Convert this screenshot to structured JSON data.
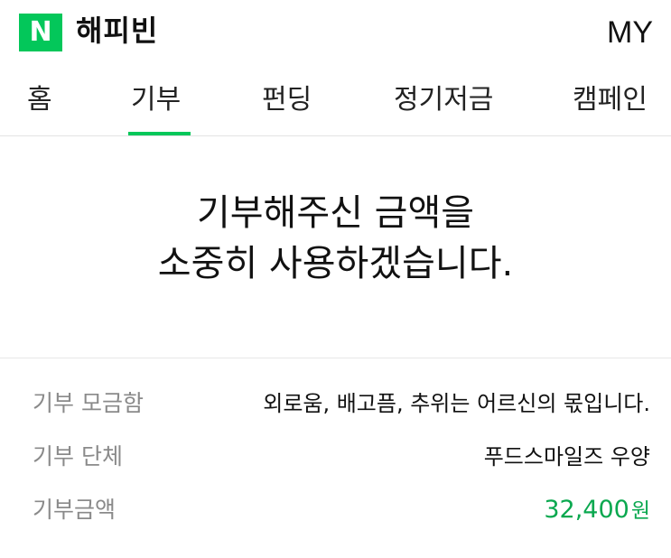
{
  "header": {
    "logo_letter": "N",
    "app_title": "해피빈",
    "my_label": "MY"
  },
  "tabs": [
    {
      "label": "홈"
    },
    {
      "label": "기부",
      "active": true
    },
    {
      "label": "펀딩"
    },
    {
      "label": "정기저금"
    },
    {
      "label": "캠페인"
    }
  ],
  "message": {
    "line1": "기부해주신 금액을",
    "line2": "소중히 사용하겠습니다."
  },
  "details": {
    "fundraiser_label": "기부 모금함",
    "fundraiser_value": "외로움, 배고픔, 추위는 어르신의 몫입니다.",
    "org_label": "기부 단체",
    "org_value": "푸드스마일즈 우양",
    "amount_label": "기부금액",
    "amount_value": "32,400",
    "amount_unit": "원"
  },
  "colors": {
    "brand_green": "#03c75a",
    "amount_green": "#0aa84f"
  }
}
